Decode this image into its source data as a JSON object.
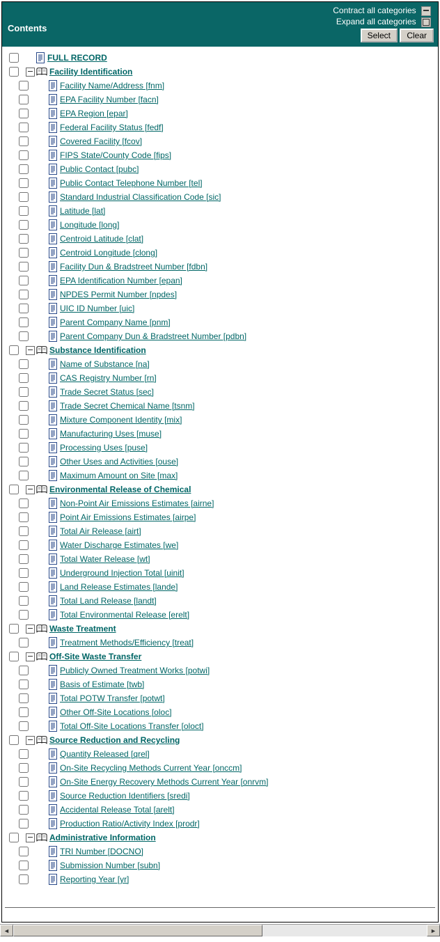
{
  "header": {
    "title": "Contents",
    "contract_label": "Contract all categories",
    "expand_label": "Expand all categories",
    "select_label": "Select",
    "clear_label": "Clear"
  },
  "full_record": "FULL RECORD",
  "categories": [
    {
      "label": "Facility Identification",
      "items": [
        "Facility Name/Address [fnm]",
        "EPA Facility Number [facn]",
        "EPA Region [epar]",
        "Federal Facility Status [fedf]",
        "Covered Facility [fcov]",
        "FIPS State/County Code [fips]",
        "Public Contact [pubc]",
        "Public Contact Telephone Number [tel]",
        "Standard Industrial Classification Code [sic]",
        "Latitude [lat]",
        "Longitude [long]",
        "Centroid Latitude [clat]",
        "Centroid Longitude [clong]",
        "Facility Dun & Bradstreet Number [fdbn]",
        "EPA Identification Number [epan]",
        "NPDES Permit Number [npdes]",
        "UIC ID Number [uic]",
        "Parent Company Name [pnm]",
        "Parent Company Dun & Bradstreet Number [pdbn]"
      ]
    },
    {
      "label": "Substance Identification",
      "items": [
        "Name of Substance [na]",
        "CAS Registry Number [rn]",
        "Trade Secret Status [sec]",
        "Trade Secret Chemical Name [tsnm]",
        "Mixture Component Identity [mix]",
        "Manufacturing Uses [muse]",
        "Processing Uses [puse]",
        "Other Uses and Activities [ouse]",
        "Maximum Amount on Site [max]"
      ]
    },
    {
      "label": "Environmental Release of Chemical",
      "items": [
        "Non-Point Air Emissions Estimates [airne]",
        "Point Air Emissions Estimates [airpe]",
        "Total Air Release [airt]",
        "Water Discharge Estimates [we]",
        "Total Water Release [wt]",
        "Underground Injection Total [uinit]",
        "Land Release Estimates [lande]",
        "Total Land Release [landt]",
        "Total Environmental Release [erelt]"
      ]
    },
    {
      "label": "Waste Treatment",
      "items": [
        "Treatment Methods/Efficiency [treat]"
      ]
    },
    {
      "label": "Off-Site Waste Transfer",
      "items": [
        "Publicly Owned Treatment Works [potwi]",
        "Basis of Estimate [twb]",
        "Total POTW Transfer [potwt]",
        "Other Off-Site Locations [oloc]",
        "Total Off-Site Locations Transfer [oloct]"
      ]
    },
    {
      "label": "Source Reduction and Recycling",
      "items": [
        "Quantity Released [qrel]",
        "On-Site Recycling Methods Current Year [onccm]",
        "On-Site Energy Recovery Methods Current Year [onrvm]",
        "Source Reduction Identifiers [sredi]",
        "Accidental Release Total [arelt]",
        "Production Ratio/Activity Index [prodr]"
      ]
    },
    {
      "label": "Administrative Information",
      "items": [
        "TRI Number [DOCNO]",
        "Submission Number [subn]",
        "Reporting Year [yr]"
      ]
    }
  ]
}
